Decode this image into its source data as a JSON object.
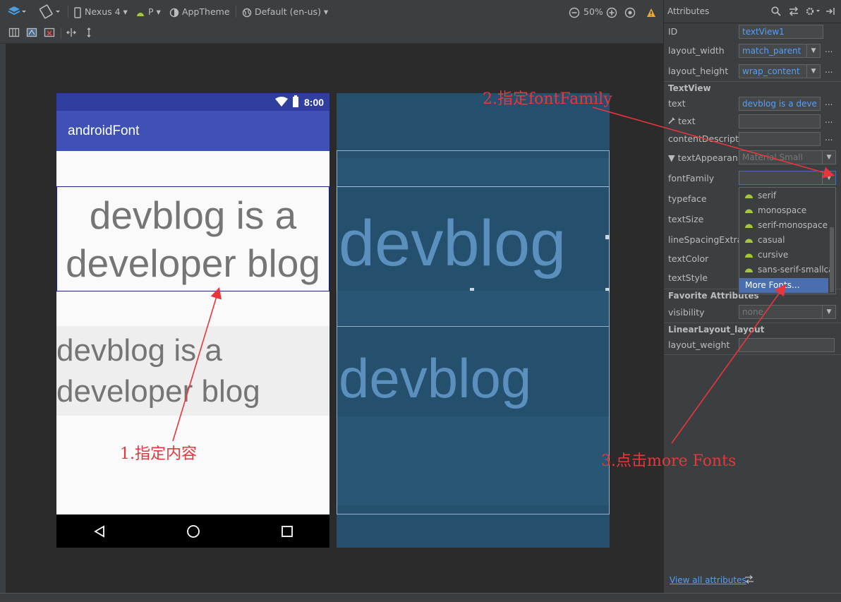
{
  "toolbar": {
    "device": "Nexus 4",
    "api": "P",
    "theme": "AppTheme",
    "locale": "Default (en-us)",
    "zoom": "50%"
  },
  "phone": {
    "status_time": "8:00",
    "app_title": "androidFont",
    "textview1_text": "devblog is a developer blog",
    "textview2_text": "devblog is a developer blog"
  },
  "blueprint": {
    "text1": "devblog",
    "text2": "devblog"
  },
  "attributes": {
    "title": "Attributes",
    "id_label": "ID",
    "id_value": "textView1",
    "layout_width_label": "layout_width",
    "layout_width_value": "match_parent",
    "layout_height_label": "layout_height",
    "layout_height_value": "wrap_content",
    "section_textview": "TextView",
    "text_label": "text",
    "text_value": "devblog is a deve",
    "tools_text_label": "text",
    "content_desc_label": "contentDescripti",
    "text_appearance_label": "textAppearan",
    "text_appearance_value": "Material.Small",
    "font_family_label": "fontFamily",
    "typeface_label": "typeface",
    "text_size_label": "textSize",
    "line_spacing_label": "lineSpacingExtra",
    "text_color_label": "textColor",
    "text_style_label": "textStyle",
    "section_favorites": "Favorite Attributes",
    "visibility_label": "visibility",
    "visibility_value": "none",
    "section_linear": "LinearLayout_layout",
    "layout_weight_label": "layout_weight",
    "view_all_link": "View all attributes",
    "more_dots": "..."
  },
  "font_dropdown": {
    "items": [
      "serif",
      "monospace",
      "serif-monospace",
      "casual",
      "cursive",
      "sans-serif-smallca"
    ],
    "more_fonts": "More Fonts..."
  },
  "annotations": {
    "a1": "1.指定内容",
    "a2": "2.指定fontFamily",
    "a3": "3.点击more Fonts",
    "color": "#e8363a"
  },
  "colors": {
    "primary": "#3f51b5",
    "primary_dark": "#303f9f",
    "blueprint": "#24506e",
    "ide_panel": "#3c3f41",
    "ide_bg": "#2b2b2b",
    "selection": "#4b6eaf",
    "android_green": "#a4c639"
  }
}
